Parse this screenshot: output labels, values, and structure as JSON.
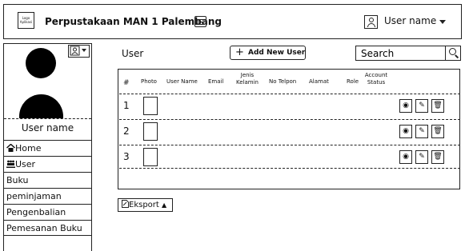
{
  "header": {
    "logo_text": "Logo Aplikasi",
    "title": "Perpustakaan MAN 1 Palembang",
    "user_name": "User name"
  },
  "sidebar": {
    "user_name": "User name",
    "items": [
      {
        "label": "Home",
        "icon": "home-icon"
      },
      {
        "label": "User",
        "icon": "users-icon"
      },
      {
        "label": "Buku"
      },
      {
        "label": "peminjaman"
      },
      {
        "label": "Pengenbalian"
      },
      {
        "label": "Pemesanan Buku"
      }
    ]
  },
  "main": {
    "title": "User",
    "add_button": "Add New User",
    "search_value": "Search",
    "export_button": "Eksport"
  },
  "table": {
    "columns": [
      "#",
      "Photo",
      "User Name",
      "Email",
      "Jenis Kelamin",
      "No Telpon",
      "Alamat",
      "Role",
      "Account Status"
    ],
    "rows": [
      {
        "no": "1"
      },
      {
        "no": "2"
      },
      {
        "no": "3"
      }
    ],
    "action_icons": [
      "eye-icon",
      "edit-icon",
      "trash-icon"
    ]
  }
}
